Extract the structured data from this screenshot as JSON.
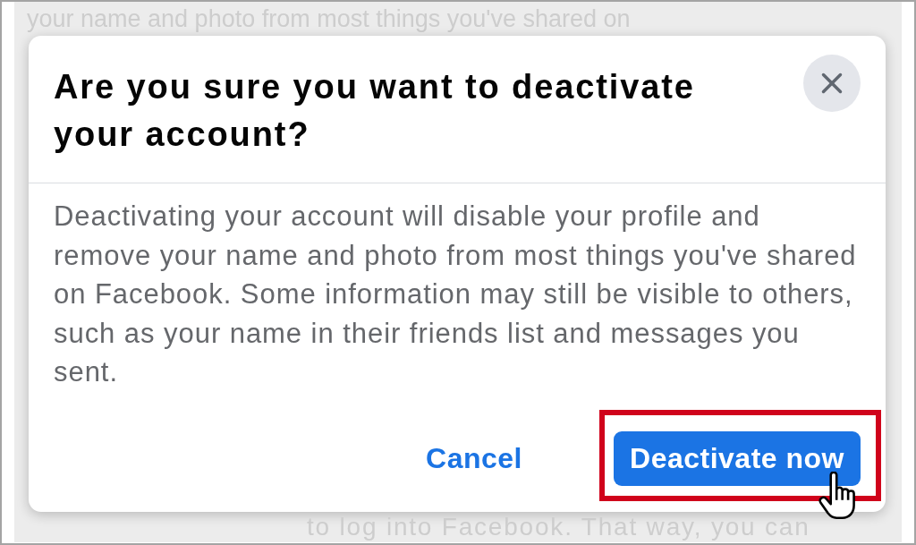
{
  "background": {
    "lines": [
      "your name and photo from most things you've shared on",
      "to log into Facebook. That way, you can"
    ]
  },
  "dialog": {
    "title": "Are you sure you want to deactivate your account?",
    "message": "Deactivating your account will disable your profile and remove your name and photo from most things you've shared on Facebook. Some information may still be visible to others, such as your name in their friends list and messages you sent.",
    "buttons": [
      {
        "label": "Cancel",
        "kind": "text",
        "highlighted": false
      },
      {
        "label": "Deactivate now",
        "kind": "primary",
        "highlighted": true
      }
    ]
  }
}
